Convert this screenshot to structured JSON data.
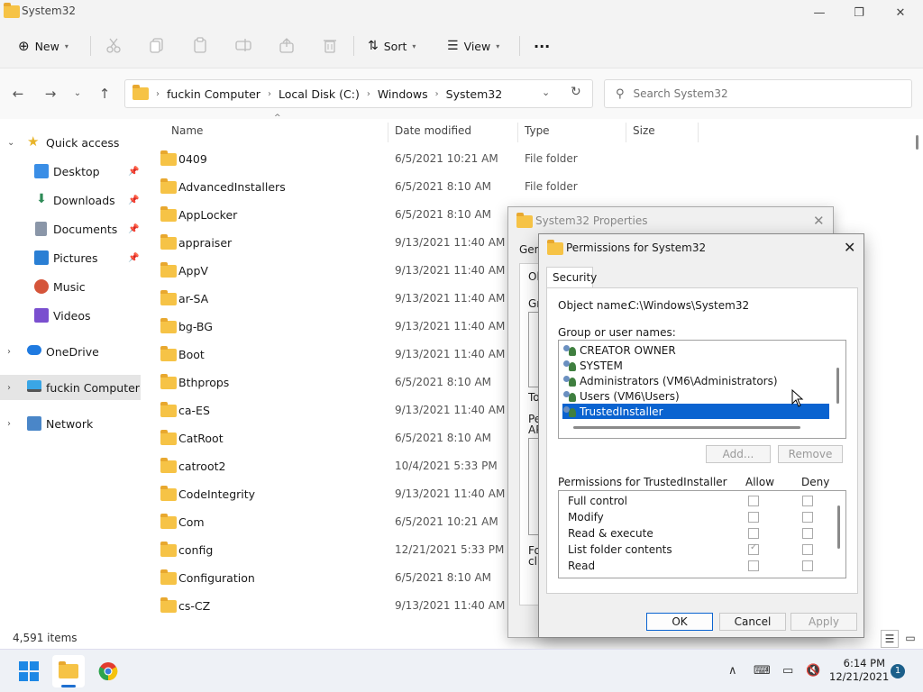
{
  "window": {
    "title": "System32"
  },
  "toolbar": {
    "new_label": "New",
    "sort_label": "Sort",
    "view_label": "View",
    "more_label": "···"
  },
  "address": {
    "crumbs": [
      "fuckin Computer",
      "Local Disk (C:)",
      "Windows",
      "System32"
    ],
    "search_placeholder": "Search System32"
  },
  "sidebar": {
    "items": [
      {
        "label": "Quick access"
      },
      {
        "label": "Desktop"
      },
      {
        "label": "Downloads"
      },
      {
        "label": "Documents"
      },
      {
        "label": "Pictures"
      },
      {
        "label": "Music"
      },
      {
        "label": "Videos"
      },
      {
        "label": "OneDrive"
      },
      {
        "label": "fuckin Computer"
      },
      {
        "label": "Network"
      }
    ]
  },
  "columns": {
    "name": "Name",
    "date": "Date modified",
    "type": "Type",
    "size": "Size"
  },
  "files": [
    {
      "name": "0409",
      "date": "6/5/2021 10:21 AM",
      "type": "File folder"
    },
    {
      "name": "AdvancedInstallers",
      "date": "6/5/2021 8:10 AM",
      "type": "File folder"
    },
    {
      "name": "AppLocker",
      "date": "6/5/2021 8:10 AM",
      "type": ""
    },
    {
      "name": "appraiser",
      "date": "9/13/2021 11:40 AM",
      "type": ""
    },
    {
      "name": "AppV",
      "date": "9/13/2021 11:40 AM",
      "type": ""
    },
    {
      "name": "ar-SA",
      "date": "9/13/2021 11:40 AM",
      "type": ""
    },
    {
      "name": "bg-BG",
      "date": "9/13/2021 11:40 AM",
      "type": ""
    },
    {
      "name": "Boot",
      "date": "9/13/2021 11:40 AM",
      "type": ""
    },
    {
      "name": "Bthprops",
      "date": "6/5/2021 8:10 AM",
      "type": ""
    },
    {
      "name": "ca-ES",
      "date": "9/13/2021 11:40 AM",
      "type": ""
    },
    {
      "name": "CatRoot",
      "date": "6/5/2021 8:10 AM",
      "type": ""
    },
    {
      "name": "catroot2",
      "date": "10/4/2021 5:33 PM",
      "type": ""
    },
    {
      "name": "CodeIntegrity",
      "date": "9/13/2021 11:40 AM",
      "type": ""
    },
    {
      "name": "Com",
      "date": "6/5/2021 10:21 AM",
      "type": ""
    },
    {
      "name": "config",
      "date": "12/21/2021 5:33 PM",
      "type": ""
    },
    {
      "name": "Configuration",
      "date": "6/5/2021 8:10 AM",
      "type": ""
    },
    {
      "name": "cs-CZ",
      "date": "9/13/2021 11:40 AM",
      "type": ""
    }
  ],
  "status": {
    "count": "4,591 items"
  },
  "properties": {
    "title": "System32 Properties",
    "tab_stub": "Gen",
    "stubs": [
      "Ob",
      "Gro",
      "To",
      "Pe",
      "AP",
      "For",
      "clic"
    ]
  },
  "permissions": {
    "title": "Permissions for System32",
    "tab": "Security",
    "object_label": "Object name:",
    "object_value": "C:\\Windows\\System32",
    "group_label": "Group or user names:",
    "users": [
      {
        "name": "CREATOR OWNER",
        "selected": false
      },
      {
        "name": "SYSTEM",
        "selected": false
      },
      {
        "name": "Administrators (VM6\\Administrators)",
        "selected": false
      },
      {
        "name": "Users (VM6\\Users)",
        "selected": false
      },
      {
        "name": "TrustedInstaller",
        "selected": true
      }
    ],
    "add_label": "Add...",
    "remove_label": "Remove",
    "perm_label": "Permissions for TrustedInstaller",
    "allow_label": "Allow",
    "deny_label": "Deny",
    "perms": [
      {
        "name": "Full control",
        "allow": false,
        "deny": false
      },
      {
        "name": "Modify",
        "allow": false,
        "deny": false
      },
      {
        "name": "Read & execute",
        "allow": false,
        "deny": false
      },
      {
        "name": "List folder contents",
        "allow": true,
        "deny": false
      },
      {
        "name": "Read",
        "allow": false,
        "deny": false
      }
    ],
    "ok_label": "OK",
    "cancel_label": "Cancel",
    "apply_label": "Apply"
  },
  "taskbar": {
    "time": "6:14 PM",
    "date": "12/21/2021",
    "notifications": "1"
  },
  "colors": {
    "accent": "#0a63d0",
    "folder": "#f6c346"
  }
}
